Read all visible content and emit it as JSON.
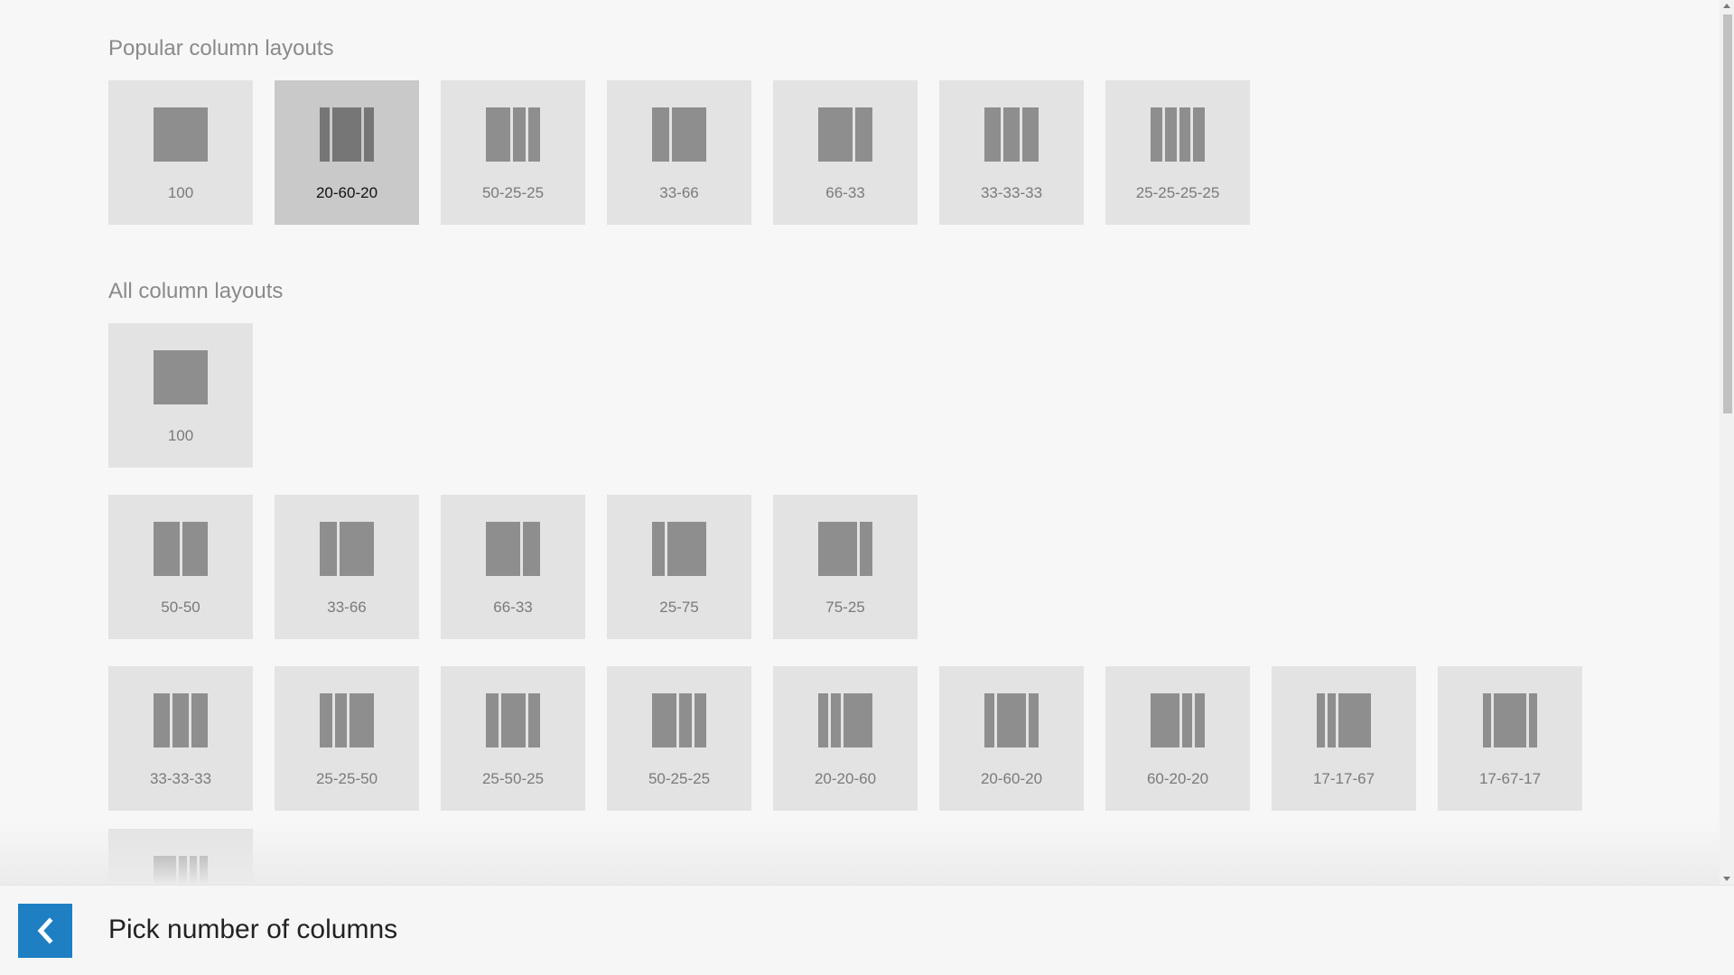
{
  "popular": {
    "title": "Popular column layouts",
    "tiles": [
      {
        "label": "100",
        "cols": [
          100
        ]
      },
      {
        "label": "20-60-20",
        "cols": [
          20,
          60,
          20
        ],
        "selected": true
      },
      {
        "label": "50-25-25",
        "cols": [
          50,
          25,
          25
        ]
      },
      {
        "label": "33-66",
        "cols": [
          33,
          66
        ]
      },
      {
        "label": "66-33",
        "cols": [
          66,
          33
        ]
      },
      {
        "label": "33-33-33",
        "cols": [
          33,
          33,
          33
        ]
      },
      {
        "label": "25-25-25-25",
        "cols": [
          25,
          25,
          25,
          25
        ]
      }
    ]
  },
  "all": {
    "title": "All column layouts",
    "rows": [
      [
        {
          "label": "100",
          "cols": [
            100
          ]
        }
      ],
      [
        {
          "label": "50-50",
          "cols": [
            50,
            50
          ]
        },
        {
          "label": "33-66",
          "cols": [
            33,
            66
          ]
        },
        {
          "label": "66-33",
          "cols": [
            66,
            33
          ]
        },
        {
          "label": "25-75",
          "cols": [
            25,
            75
          ]
        },
        {
          "label": "75-25",
          "cols": [
            75,
            25
          ]
        }
      ],
      [
        {
          "label": "33-33-33",
          "cols": [
            33,
            33,
            33
          ]
        },
        {
          "label": "25-25-50",
          "cols": [
            25,
            25,
            50
          ]
        },
        {
          "label": "25-50-25",
          "cols": [
            25,
            50,
            25
          ]
        },
        {
          "label": "50-25-25",
          "cols": [
            50,
            25,
            25
          ]
        },
        {
          "label": "20-20-60",
          "cols": [
            20,
            20,
            60
          ]
        },
        {
          "label": "20-60-20",
          "cols": [
            20,
            60,
            20
          ]
        },
        {
          "label": "60-20-20",
          "cols": [
            60,
            20,
            20
          ]
        },
        {
          "label": "17-17-67",
          "cols": [
            17,
            17,
            67
          ]
        },
        {
          "label": "17-67-17",
          "cols": [
            17,
            67,
            17
          ]
        }
      ],
      [
        {
          "label": "",
          "cols": [
            50,
            17,
            17,
            17
          ]
        }
      ]
    ]
  },
  "footer": {
    "title": "Pick number of columns",
    "back_icon": "chevron-left-icon",
    "accent_color": "#1e7fc3"
  }
}
